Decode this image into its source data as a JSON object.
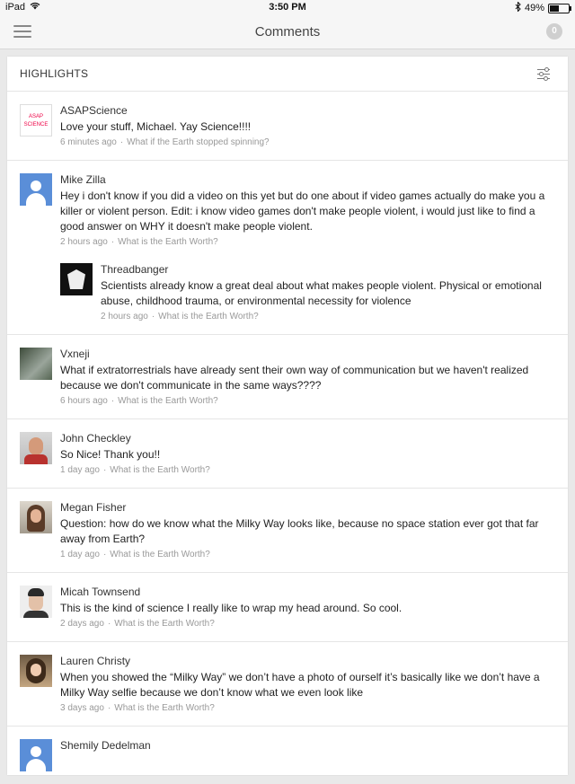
{
  "status_bar": {
    "device": "iPad",
    "time": "3:50 PM",
    "battery": "49%",
    "battery_level": 0.49
  },
  "nav": {
    "title": "Comments",
    "count": "0"
  },
  "highlights": {
    "title": "HIGHLIGHTS"
  },
  "comments": [
    {
      "author": "ASAPScience",
      "text": "Love your stuff, Michael. Yay Science!!!!",
      "time": "6 minutes ago",
      "video": "What if the Earth stopped spinning?"
    },
    {
      "author": "Mike Zilla",
      "text": "Hey i don't know if you did a video on this yet but do one about if video games actually do make you a killer or violent person. Edit: i know video games don't make people violent, i would just like to find a good answer on WHY it doesn't make people violent.",
      "time": "2 hours ago",
      "video": "What is the Earth Worth?",
      "reply": {
        "author": "Threadbanger",
        "text": "Scientists already know a great deal about what makes people violent. Physical or emotional abuse, childhood trauma, or environmental necessity for violence",
        "time": "2 hours ago",
        "video": "What is the Earth Worth?"
      }
    },
    {
      "author": "Vxneji",
      "text": "What if extratorrestrials have already sent their own way of communication but we haven't realized because we don't communicate in the same ways????",
      "time": "6 hours ago",
      "video": "What is the Earth Worth?"
    },
    {
      "author": "John Checkley",
      "text": "So Nice! Thank you!!",
      "time": "1 day ago",
      "video": "What is the Earth Worth?"
    },
    {
      "author": "Megan Fisher",
      "text": "Question: how do we know what the Milky Way looks like, because no space station ever got that far away from Earth?",
      "time": "1 day ago",
      "video": "What is the Earth Worth?"
    },
    {
      "author": "Micah Townsend",
      "text": "This is the kind of science I really like to wrap my head around. So cool.",
      "time": "2 days ago",
      "video": "What is the Earth Worth?"
    },
    {
      "author": "Lauren Christy",
      "text": "When you showed the “Milky Way” we don’t have a photo of ourself it’s basically like we don’t have a Milky Way selfie because we don’t know what we even look like",
      "time": "3 days ago",
      "video": "What is the Earth Worth?"
    },
    {
      "author": "Shemily Dedelman"
    }
  ],
  "asap_logo_text": "ASAP SCIENCE"
}
